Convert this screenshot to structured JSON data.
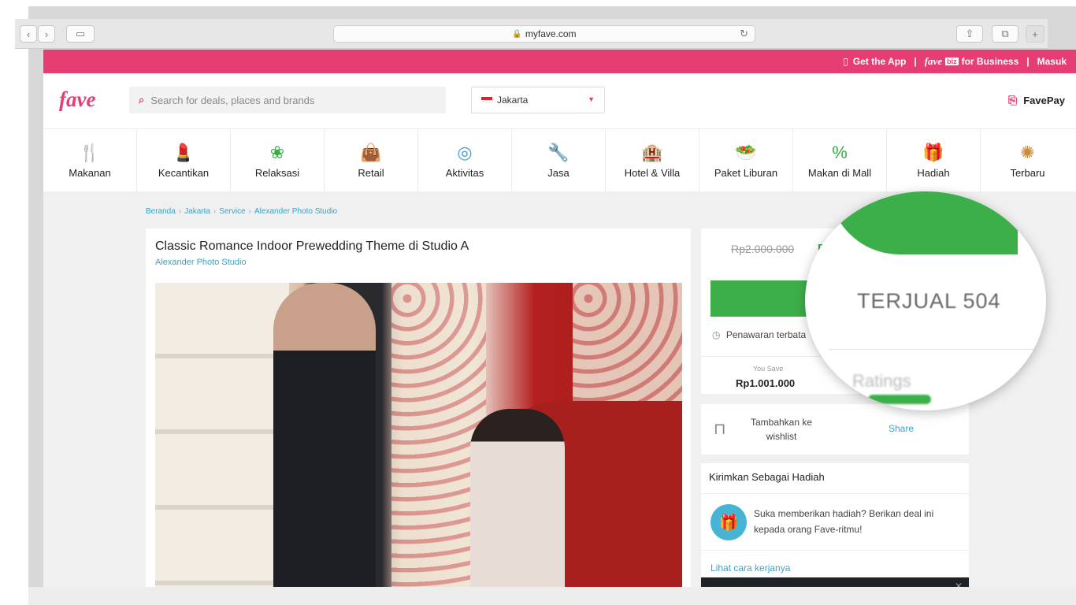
{
  "browser": {
    "url": "myfave.com",
    "back_icon": "chevron-left-icon",
    "forward_icon": "chevron-right-icon",
    "sidebar_icon": "sidebar-icon",
    "reload_icon": "reload-icon",
    "share_icon": "share-icon",
    "tabs_icon": "tabs-icon",
    "new_tab_icon": "plus-icon"
  },
  "topbar": {
    "get_app": "Get the App",
    "sep1": "|",
    "fave_word": "fave",
    "biz_badge": "biz",
    "for_business": "for Business",
    "sep2": "|",
    "login": "Masuk"
  },
  "header": {
    "logo": "fave",
    "search_placeholder": "Search for deals, places and brands",
    "city": "Jakarta",
    "favepay": "FavePay"
  },
  "categories": [
    {
      "label": "Makanan",
      "icon": "utensils-icon",
      "glyph": "🍴",
      "color": "#4a9fd0"
    },
    {
      "label": "Kecantikan",
      "icon": "lipstick-icon",
      "glyph": "💄",
      "color": "#e63e73"
    },
    {
      "label": "Relaksasi",
      "icon": "lotus-icon",
      "glyph": "❀",
      "color": "#3aaa48"
    },
    {
      "label": "Retail",
      "icon": "shopping-bag-icon",
      "glyph": "👜",
      "color": "#333333"
    },
    {
      "label": "Aktivitas",
      "icon": "target-icon",
      "glyph": "◎",
      "color": "#4a9fd0"
    },
    {
      "label": "Jasa",
      "icon": "wrench-icon",
      "glyph": "🔧",
      "color": "#666666"
    },
    {
      "label": "Hotel & Villa",
      "icon": "building-icon",
      "glyph": "🏨",
      "color": "#c98a3a"
    },
    {
      "label": "Paket Liburan",
      "icon": "plate-icon",
      "glyph": "🥗",
      "color": "#3aaa48"
    },
    {
      "label": "Makan di Mall",
      "icon": "discount-bag-icon",
      "glyph": "%",
      "color": "#3aaa48"
    },
    {
      "label": "Hadiah",
      "icon": "gift-icon",
      "glyph": "🎁",
      "color": "#e63e73"
    },
    {
      "label": "Terbaru",
      "icon": "new-badge-icon",
      "glyph": "✺",
      "color": "#c98a3a"
    }
  ],
  "breadcrumb": [
    "Beranda",
    "Jakarta",
    "Service",
    "Alexander Photo Studio"
  ],
  "breadcrumb_sep": "›",
  "deal": {
    "title": "Classic Romance Indoor Prewedding Theme di Studio A",
    "merchant": "Alexander Photo Studio"
  },
  "pricing": {
    "old_price": "Rp2.000.000",
    "new_price": "R",
    "buy_button": "B",
    "limited": "Penawaran terbata",
    "you_save_label": "You Save",
    "you_save_value": "Rp1.001.000"
  },
  "wishlist": {
    "label": "Tambahkan ke wishlist",
    "share": "Share"
  },
  "gift": {
    "title": "Kirimkan Sebagai Hadiah",
    "text": "Suka memberikan hadiah? Berikan deal ini kepada orang Fave-ritmu!",
    "link": "Lihat cara kerjanya"
  },
  "magnifier": {
    "sold": "TERJUAL 504",
    "ratings": "Ratings"
  },
  "colors": {
    "brand_pink": "#e63e73",
    "green": "#3daf4a",
    "link_blue": "#3aa3c6"
  }
}
